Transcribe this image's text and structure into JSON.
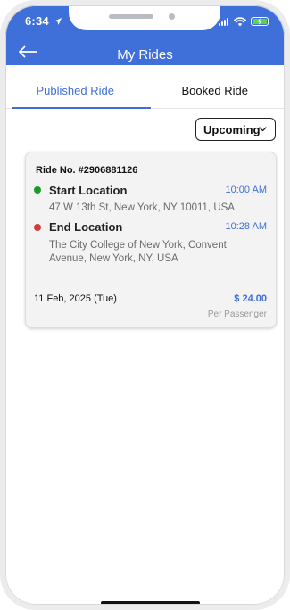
{
  "status_bar": {
    "time": "6:34",
    "icons": [
      "location-arrow-icon",
      "signal-icon",
      "wifi-icon",
      "battery-charging-icon"
    ],
    "battery_color": "#5ad34f"
  },
  "header": {
    "title": "My Rides",
    "back_icon": "arrow-left-icon",
    "background_color": "#3f6fd8"
  },
  "tabs": [
    {
      "label": "Published Ride",
      "active": true
    },
    {
      "label": "Booked Ride",
      "active": false
    }
  ],
  "filter": {
    "selected": "Upcoming",
    "icon": "chevron-down-icon"
  },
  "rides": [
    {
      "ride_no_label": "Ride No. #2906881126",
      "start": {
        "title": "Start Location",
        "time": "10:00 AM",
        "address": "47 W 13th St, New York, NY 10011, USA",
        "dot_color": "#1b9a2a"
      },
      "end": {
        "title": "End Location",
        "time": "10:28 AM",
        "address": "The City College of New York, Convent Avenue, New York, NY, USA",
        "dot_color": "#d23c3c"
      },
      "date": "11 Feb, 2025 (Tue)",
      "price": "$ 24.00",
      "price_caption": "Per Passenger"
    }
  ],
  "colors": {
    "accent": "#3f6fd8",
    "start_dot": "#1b9a2a",
    "end_dot": "#d23c3c"
  }
}
